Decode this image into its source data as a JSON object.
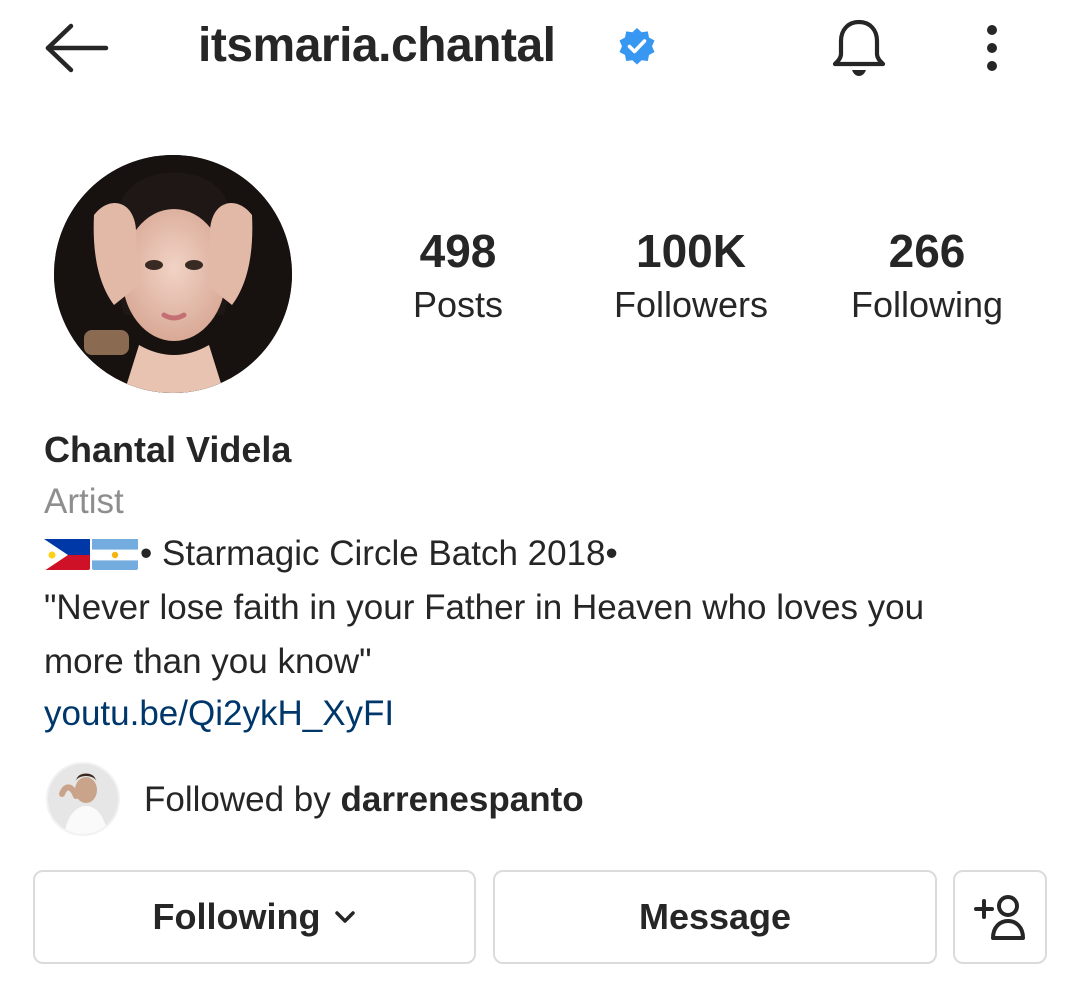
{
  "header": {
    "username": "itsmaria.chantal",
    "verified_color": "#3897f0"
  },
  "icons": {
    "back": "arrow-left-icon",
    "verified": "verified-badge-icon",
    "bell": "bell-icon",
    "more": "more-vertical-icon",
    "chevron": "chevron-down-icon",
    "add_user": "add-user-icon"
  },
  "stats": {
    "posts": {
      "value": "498",
      "label": "Posts"
    },
    "followers": {
      "value": "100K",
      "label": "Followers"
    },
    "following": {
      "value": "266",
      "label": "Following"
    }
  },
  "bio": {
    "full_name": "Chantal Videla",
    "category": "Artist",
    "flags": [
      "philippines-flag",
      "argentina-flag"
    ],
    "line1_text": "• Starmagic Circle Batch 2018•",
    "line2_text": "\"Never lose faith in your Father in Heaven who loves you",
    "line3_text": "more than you know\"",
    "link": "youtu.be/Qi2ykH_XyFI",
    "link_color": "#00376b"
  },
  "mutual": {
    "prefix": "Followed by ",
    "username": "darrenespanto"
  },
  "actions": {
    "following_label": "Following",
    "message_label": "Message"
  }
}
